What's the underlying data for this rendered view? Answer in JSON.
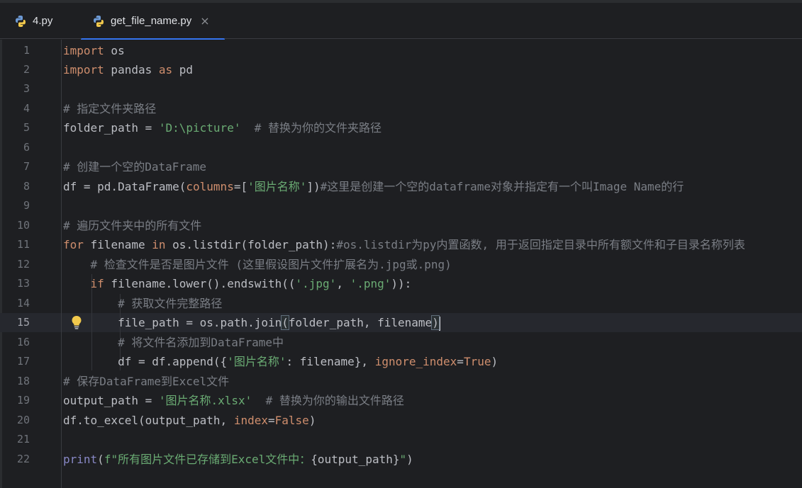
{
  "tabs": [
    {
      "label": "4.py",
      "active": false
    },
    {
      "label": "get_file_name.py",
      "active": true,
      "close": "×"
    }
  ],
  "editor": {
    "current_line": 15,
    "lines": [
      {
        "n": "1"
      },
      {
        "n": "2"
      },
      {
        "n": "3"
      },
      {
        "n": "4"
      },
      {
        "n": "5"
      },
      {
        "n": "6"
      },
      {
        "n": "7"
      },
      {
        "n": "8"
      },
      {
        "n": "9"
      },
      {
        "n": "10"
      },
      {
        "n": "11"
      },
      {
        "n": "12"
      },
      {
        "n": "13"
      },
      {
        "n": "14"
      },
      {
        "n": "15"
      },
      {
        "n": "16"
      },
      {
        "n": "17"
      },
      {
        "n": "18"
      },
      {
        "n": "19"
      },
      {
        "n": "20"
      },
      {
        "n": "21"
      },
      {
        "n": "22"
      }
    ],
    "tokens": {
      "l1": [
        "import",
        " os"
      ],
      "l2": [
        "import",
        " pandas ",
        "as",
        " pd"
      ],
      "l4": [
        "# 指定文件夹路径"
      ],
      "l5": [
        "folder_path = ",
        "'D:\\picture'",
        "  # 替换为你的文件夹路径"
      ],
      "l7": [
        "# 创建一个空的DataFrame"
      ],
      "l8": [
        "df = pd.DataFrame(",
        "columns",
        "=[",
        "'图片名称'",
        "])",
        "#这里是创建一个空的dataframe对象并指定有一个叫Image Name的行"
      ],
      "l10": [
        "# 遍历文件夹中的所有文件"
      ],
      "l11": [
        "for",
        " filename ",
        "in",
        " os.listdir(folder_path):",
        "#os.listdir为py内置函数, 用于返回指定目录中所有额文件和子目录名称列表"
      ],
      "l12": [
        "    ",
        "# 检查文件是否是图片文件 (这里假设图片文件扩展名为.jpg或.png)"
      ],
      "l13": [
        "    ",
        "if",
        " filename.lower().endswith((",
        "'.jpg'",
        ", ",
        "'.png'",
        ")):"
      ],
      "l14": [
        "        ",
        "# 获取文件完整路径"
      ],
      "l15": [
        "        file_path = os.path.join",
        "(",
        "folder_path, filename",
        ")"
      ],
      "l16": [
        "        ",
        "# 将文件名添加到DataFrame中"
      ],
      "l17": [
        "        df = df.append({",
        "'图片名称'",
        ": filename}, ",
        "ignore_index",
        "=",
        "True",
        ")"
      ],
      "l18": [
        "# 保存DataFrame到Excel文件"
      ],
      "l19": [
        "output_path = ",
        "'图片名称.xlsx'",
        "  # 替换为你的输出文件路径"
      ],
      "l20": [
        "df.to_excel(output_path, ",
        "index",
        "=",
        "False",
        ")"
      ],
      "l22": [
        "print",
        "(",
        "f\"所有图片文件已存储到Excel文件中：",
        "{output_path}",
        "\"",
        ")"
      ]
    }
  },
  "icons": {
    "tab_file_icon": "python-file-icon",
    "gutter_icon": "lightbulb-icon"
  },
  "colors": {
    "background": "#1e1f22",
    "keyword": "#cf8e6d",
    "string": "#6aab73",
    "comment": "#7a7e85",
    "builtin": "#8888c6",
    "text": "#bcbec4",
    "tab_active_underline": "#3574f0"
  }
}
